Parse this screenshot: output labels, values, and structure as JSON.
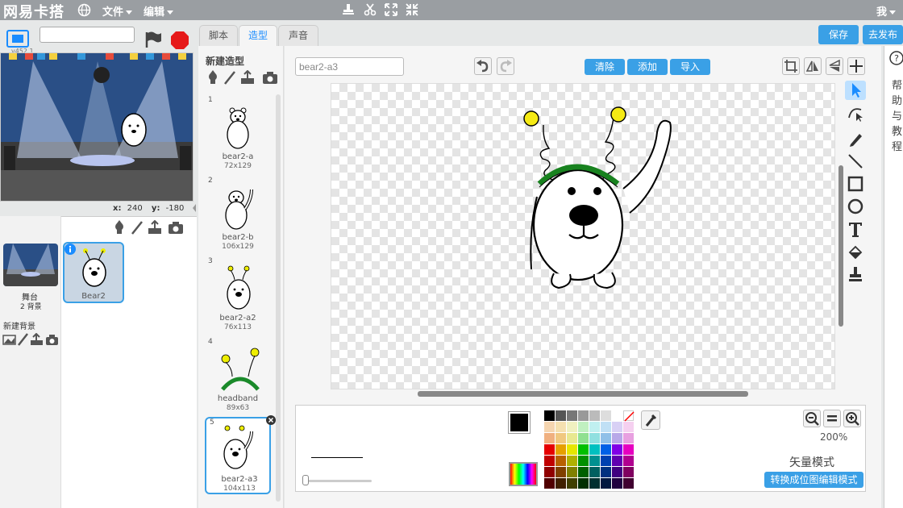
{
  "menubar": {
    "brand": "网易卡搭",
    "file_label": "文件",
    "edit_label": "编辑",
    "user_label": "我"
  },
  "stage": {
    "version": "v452.1",
    "project_name": "",
    "x_label": "x:",
    "x_value": "240",
    "y_label": "y:",
    "y_value": "-180"
  },
  "stage_col": {
    "name": "舞台",
    "backdrops": "2 背景",
    "new_backdrop": "新建背景"
  },
  "sprites": [
    {
      "name": "Bear2"
    }
  ],
  "tabs": [
    {
      "label": "脚本"
    },
    {
      "label": "造型"
    },
    {
      "label": "声音"
    }
  ],
  "top_right": {
    "save_label": "保存",
    "publish_label": "去发布"
  },
  "costumes": {
    "heading": "新建造型",
    "items": [
      {
        "num": "1",
        "name": "bear2-a",
        "size": "72x129"
      },
      {
        "num": "2",
        "name": "bear2-b",
        "size": "106x129"
      },
      {
        "num": "3",
        "name": "bear2-a2",
        "size": "76x113"
      },
      {
        "num": "4",
        "name": "headband",
        "size": "89x63"
      },
      {
        "num": "5",
        "name": "bear2-a3",
        "size": "104x113"
      }
    ]
  },
  "editor": {
    "costume_name": "bear2-a3",
    "clear_label": "清除",
    "add_label": "添加",
    "import_label": "导入",
    "zoom": "200%",
    "mode_label": "矢量模式",
    "convert_label": "转换成位图编辑模式",
    "fill_color": "#000000"
  },
  "help": {
    "text": "帮助与教程"
  },
  "colors": {
    "accent": "#3aa0e6",
    "menubar": "#9a9ea2"
  }
}
